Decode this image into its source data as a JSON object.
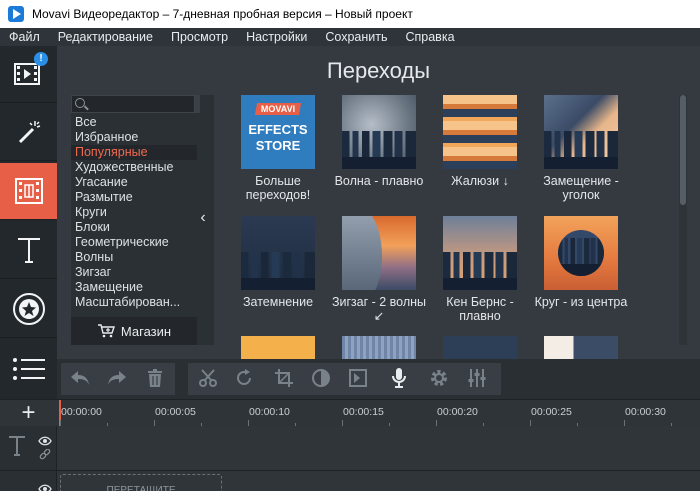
{
  "window": {
    "title": "Movavi Видеоредактор – 7-дневная пробная версия – Новый проект"
  },
  "menu": [
    "Файл",
    "Редактирование",
    "Просмотр",
    "Настройки",
    "Сохранить",
    "Справка"
  ],
  "toolstrip": {
    "items": [
      {
        "name": "import-media",
        "icon": "film-import-icon",
        "badge": "!"
      },
      {
        "name": "filters",
        "icon": "magic-wand-icon"
      },
      {
        "name": "transitions",
        "icon": "transitions-icon",
        "active": true
      },
      {
        "name": "titles",
        "icon": "text-t-icon"
      },
      {
        "name": "stickers",
        "icon": "star-sticker-icon"
      },
      {
        "name": "more",
        "icon": "list-icon"
      }
    ]
  },
  "panel": {
    "title": "Переходы",
    "search_clear": "✕",
    "categories": [
      "Все",
      "Избранное",
      "Популярные",
      "Художественные",
      "Угасание",
      "Размытие",
      "Круги",
      "Блоки",
      "Геометрические",
      "Волны",
      "Зигзаг",
      "Замещение",
      "Масштабирован..."
    ],
    "selected_category": "Популярные",
    "shop_label": "Магазин",
    "collapse_glyph": "‹"
  },
  "gallery": {
    "store_tile": {
      "brand": "MOVAVI",
      "line1": "EFFECTS",
      "line2": "STORE"
    },
    "tiles": [
      "Больше переходов!",
      "Волна - плавно",
      "Жалюзи ↓",
      "Замещение - уголок",
      "Затемнение",
      "Зигзаг - 2 волны ↙",
      "Кен Бернс - плавно",
      "Круг - из центра"
    ]
  },
  "timeline": {
    "add_track": "+",
    "ruler": [
      "00:00:00",
      "00:00:05",
      "00:00:10",
      "00:00:15",
      "00:00:20",
      "00:00:25",
      "00:00:30"
    ],
    "drop_hint": "ПЕРЕТАЩИТЕ"
  },
  "colors": {
    "accent": "#e85f48",
    "badge": "#2a8fe6",
    "panel_bg": "#343a40",
    "sidebar_bg": "#23282c"
  }
}
